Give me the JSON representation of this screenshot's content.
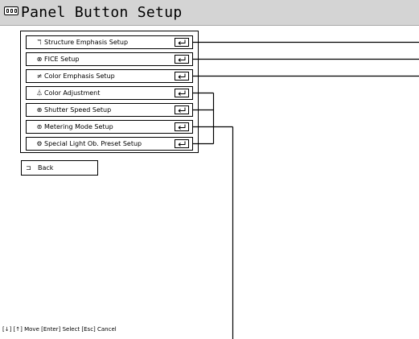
{
  "window": {
    "title": "Panel Button Setup",
    "title_icon": "panel-keyboard-icon"
  },
  "menu": {
    "items": [
      {
        "label": "Structure Emphasis Setup",
        "icon": "structure-emphasis-icon",
        "glyph": "ℸ"
      },
      {
        "label": "FICE Setup",
        "icon": "fice-icon",
        "glyph": "⊗"
      },
      {
        "label": "Color Emphasis Setup",
        "icon": "color-emphasis-icon",
        "glyph": "≠"
      },
      {
        "label": "Color Adjustment",
        "icon": "color-adjustment-icon",
        "glyph": "⏃"
      },
      {
        "label": "Shutter Speed Setup",
        "icon": "shutter-speed-icon",
        "glyph": "⊕"
      },
      {
        "label": "Metering Mode Setup",
        "icon": "metering-mode-icon",
        "glyph": "⊚"
      },
      {
        "label": "Special Light Ob. Preset Setup",
        "icon": "special-light-icon",
        "glyph": "⚙"
      }
    ],
    "enter_icon": "enter-key-icon"
  },
  "back": {
    "label": "Back",
    "icon": "back-icon",
    "glyph": "⊐"
  },
  "footer": {
    "hint": "[↓] [↑] Move  [Enter] Select  [Esc] Cancel"
  }
}
